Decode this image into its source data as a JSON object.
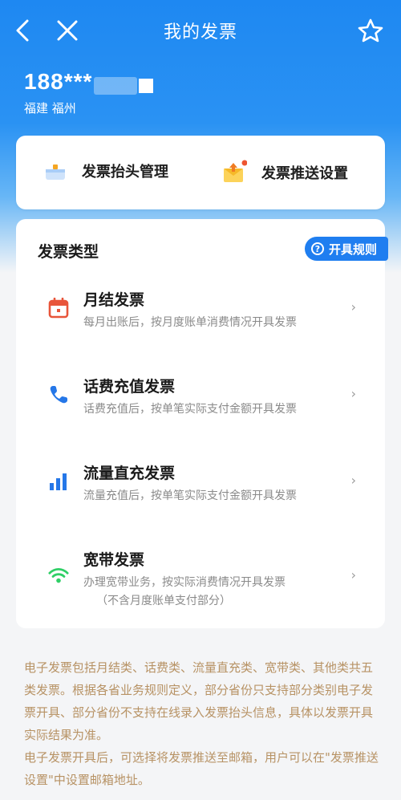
{
  "nav": {
    "title": "我的发票",
    "back_icon": "back-arrow-icon",
    "close_icon": "close-icon",
    "favorite_icon": "star-icon"
  },
  "account": {
    "phone": "188***",
    "region": "福建 福州"
  },
  "quick_actions": [
    {
      "label": "发票抬头管理",
      "icon": "invoice-title-icon"
    },
    {
      "label": "发票推送设置",
      "icon": "invoice-push-icon"
    }
  ],
  "invoice_types": {
    "title": "发票类型",
    "rules_label": "开具规则",
    "items": [
      {
        "title": "月结发票",
        "desc": "每月出账后，按月度账单消费情况开具发票",
        "icon": "calendar-icon"
      },
      {
        "title": "话费充值发票",
        "desc": "话费充值后，按单笔实际支付金额开具发票",
        "icon": "phone-icon"
      },
      {
        "title": "流量直充发票",
        "desc": "流量充值后，按单笔实际支付金额开具发票",
        "icon": "signal-bars-icon"
      },
      {
        "title": "宽带发票",
        "desc": "办理宽带业务，按实际消费情况开具发票",
        "desc2": "（不含月度账单支付部分）",
        "icon": "wifi-icon"
      }
    ],
    "chevron": "›"
  },
  "notes": [
    "电子发票包括月结类、话费类、流量直充类、宽带类、其他类共五类发票。根据各省业务规则定义，部分省份只支持部分类别电子发票开具、部分省份不支持在线录入发票抬头信息，具体以发票开具实际结果为准。",
    "电子发票开具后，可选择将发票推送至邮箱，用户可以在\"发票推送设置\"中设置邮箱地址。"
  ],
  "colors": {
    "brand_blue": "#1e88f2",
    "notes_text": "#b79264",
    "calendar_red": "#e8553a",
    "wifi_green": "#2fcf66"
  }
}
